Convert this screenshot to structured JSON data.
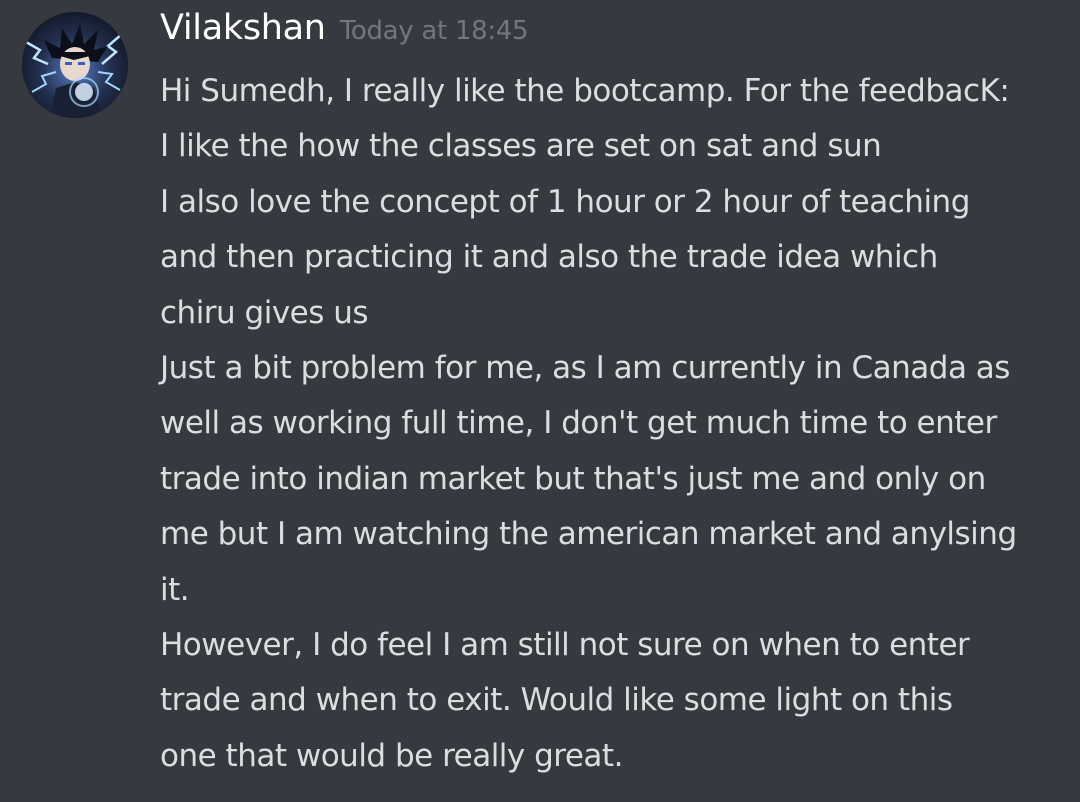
{
  "message": {
    "author": "Vilakshan",
    "timestamp": "Today at 18:45",
    "lines": [
      "Hi Sumedh, I really like the bootcamp. For the feedbacK:",
      "I like the how the classes are set on sat and sun",
      "I also love the concept of 1 hour or 2 hour of teaching",
      "and then practicing it and also the trade idea which",
      "chiru gives us",
      "Just a bit problem for me, as I am currently in Canada as",
      "well as working full time, I don't get much time to enter",
      "trade into indian market but that's just me and only on",
      "me but I am watching the american market and anylsing",
      "it.",
      "However, I do feel I am still not sure on when to enter",
      "trade and when to exit. Would like some light on this",
      "one that would be really great."
    ]
  },
  "colors": {
    "background": "#36393f",
    "username": "#ffffff",
    "timestamp": "#72767d",
    "text": "#dcddde"
  },
  "icons": {
    "avatar": "anime-character-avatar"
  }
}
